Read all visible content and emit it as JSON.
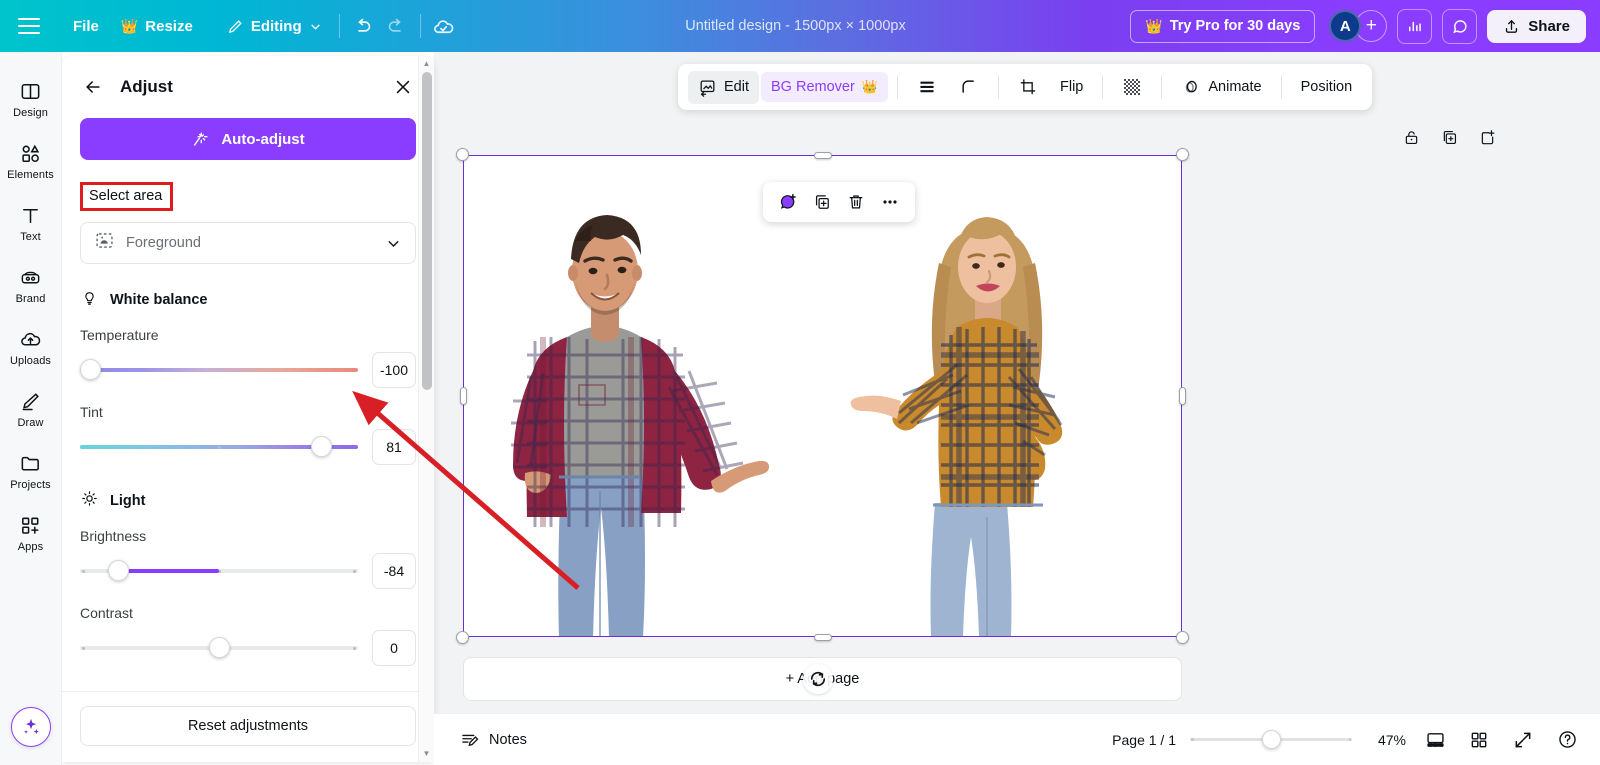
{
  "topbar": {
    "menu_icon": "hamburger-icon",
    "file_label": "File",
    "resize_label": "Resize",
    "resize_badge": "crown-icon",
    "editing_label": "Editing",
    "undo_icon": "undo-icon",
    "redo_icon": "redo-icon",
    "saved_icon": "cloud-check-icon",
    "design_title": "Untitled design - 1500px × 1000px",
    "try_pro_label": "Try Pro for 30 days",
    "avatar_initial": "A",
    "add_collaborator_icon": "plus-icon",
    "insights_icon": "bar-chart-icon",
    "comments_icon": "comment-icon",
    "share_label": "Share",
    "share_icon": "share-upload-icon"
  },
  "sidebar": {
    "items": [
      {
        "label": "Design",
        "icon": "design-icon"
      },
      {
        "label": "Elements",
        "icon": "elements-icon"
      },
      {
        "label": "Text",
        "icon": "text-icon"
      },
      {
        "label": "Brand",
        "icon": "brand-icon"
      },
      {
        "label": "Uploads",
        "icon": "uploads-icon"
      },
      {
        "label": "Draw",
        "icon": "draw-icon"
      },
      {
        "label": "Projects",
        "icon": "projects-icon"
      },
      {
        "label": "Apps",
        "icon": "apps-icon"
      }
    ],
    "magic_button_icon": "magic-sparkle-icon"
  },
  "panel": {
    "title": "Adjust",
    "back_icon": "back-arrow-icon",
    "close_icon": "close-icon",
    "auto_adjust_label": "Auto-adjust",
    "auto_adjust_icon": "magic-wand-icon",
    "select_area_label": "Select area",
    "select_area_highlight_color": "#e01b1b",
    "area_dropdown": {
      "icon": "image-foreground-icon",
      "value": "Foreground",
      "chevron": "chevron-down-icon"
    },
    "sections": [
      {
        "title": "White balance",
        "icon": "lightbulb-icon",
        "sliders": [
          {
            "label": "Temperature",
            "value": "-100",
            "pct": 0,
            "track": "temperature-gradient"
          },
          {
            "label": "Tint",
            "value": "81",
            "pct": 90,
            "track": "tint-gradient"
          }
        ]
      },
      {
        "title": "Light",
        "icon": "sun-icon",
        "sliders": [
          {
            "label": "Brightness",
            "value": "-84",
            "pct": 11,
            "track": "plain"
          },
          {
            "label": "Contrast",
            "value": "0",
            "pct": 50,
            "track": "plain"
          }
        ]
      }
    ],
    "reset_label": "Reset adjustments",
    "accent_color": "#8b3dff"
  },
  "canvas_toolbar": {
    "edit_label": "Edit",
    "edit_icon": "image-edit-icon",
    "bg_remover_label": "BG Remover",
    "bg_remover_badge": "crown-icon",
    "layers_icon": "layers-icon",
    "corner_icon": "corner-radius-icon",
    "crop_icon": "crop-icon",
    "flip_label": "Flip",
    "transparency_icon": "transparency-icon",
    "animate_label": "Animate",
    "animate_icon": "animate-icon",
    "position_label": "Position"
  },
  "page_tools": {
    "lock_icon": "lock-icon",
    "duplicate_icon": "duplicate-page-icon",
    "add_page_icon": "add-page-icon"
  },
  "element_toolbar": {
    "comment_icon": "add-comment-icon",
    "duplicate_icon": "duplicate-icon",
    "delete_icon": "trash-icon",
    "more_icon": "more-options-icon"
  },
  "canvas": {
    "add_page_label": "+ Add page",
    "selection_color": "#6b2fd4",
    "cursor_icon": "loading-spinner-cursor"
  },
  "bottombar": {
    "notes_label": "Notes",
    "notes_icon": "notes-icon",
    "page_indicator": "Page 1 / 1",
    "zoom_value": "47%",
    "presenter_icon": "presenter-view-icon",
    "grid_icon": "grid-view-icon",
    "fullscreen_icon": "fullscreen-icon",
    "help_icon": "help-icon"
  },
  "annotation": {
    "arrow_color": "#d81f26",
    "arrow_from": "canvas-image",
    "arrow_to": "tint-value-field"
  }
}
